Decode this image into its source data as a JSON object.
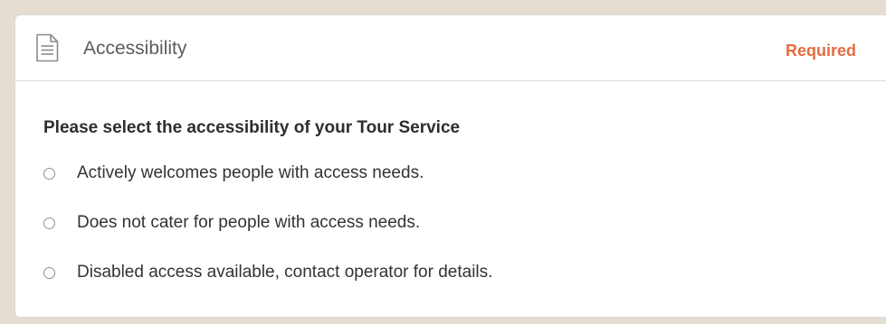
{
  "section": {
    "icon": "document-icon",
    "title": "Accessibility",
    "required_label": "Required",
    "required_color": "#e46c3f"
  },
  "question": {
    "text": "Please select the accessibility of your Tour Service"
  },
  "options": [
    {
      "label": "Actively welcomes people with access needs.",
      "selected": false
    },
    {
      "label": "Does not cater for people with access needs.",
      "selected": false
    },
    {
      "label": "Disabled access available, contact operator for details.",
      "selected": false
    }
  ]
}
